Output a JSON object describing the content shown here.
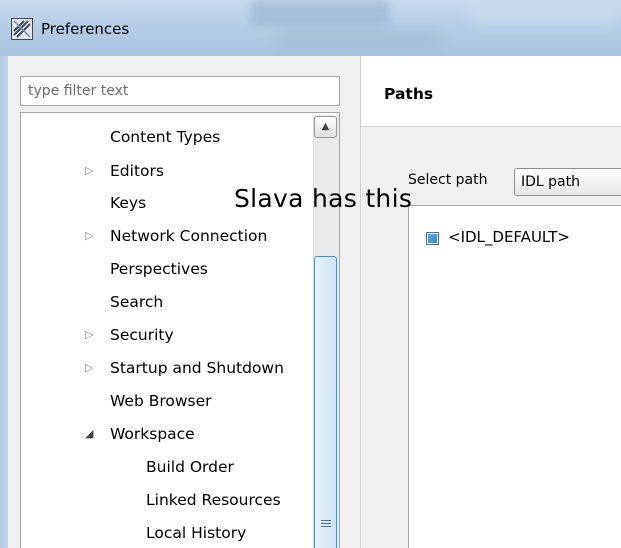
{
  "window": {
    "title": "Preferences",
    "icon": "preferences-icon"
  },
  "filter": {
    "placeholder": "type filter text"
  },
  "tree": {
    "items": [
      {
        "label": "Content Types",
        "expandable": false,
        "expanded": false,
        "level": 1
      },
      {
        "label": "Editors",
        "expandable": true,
        "expanded": false,
        "level": 1
      },
      {
        "label": "Keys",
        "expandable": false,
        "expanded": false,
        "level": 1
      },
      {
        "label": "Network Connection",
        "expandable": true,
        "expanded": false,
        "level": 1
      },
      {
        "label": "Perspectives",
        "expandable": false,
        "expanded": false,
        "level": 1
      },
      {
        "label": "Search",
        "expandable": false,
        "expanded": false,
        "level": 1
      },
      {
        "label": "Security",
        "expandable": true,
        "expanded": false,
        "level": 1
      },
      {
        "label": "Startup and Shutdown",
        "expandable": true,
        "expanded": false,
        "level": 1
      },
      {
        "label": "Web Browser",
        "expandable": false,
        "expanded": false,
        "level": 1
      },
      {
        "label": "Workspace",
        "expandable": true,
        "expanded": true,
        "level": 1
      },
      {
        "label": "Build Order",
        "expandable": false,
        "expanded": false,
        "level": 2
      },
      {
        "label": "Linked Resources",
        "expandable": false,
        "expanded": false,
        "level": 2
      },
      {
        "label": "Local History",
        "expandable": false,
        "expanded": false,
        "level": 2
      }
    ]
  },
  "page": {
    "title": "Paths",
    "select_label": "Select path",
    "select_value": "IDL path",
    "paths": [
      {
        "label": "<IDL_DEFAULT>",
        "checked": true
      }
    ]
  },
  "annotation": {
    "text": "Slava has this"
  },
  "colors": {
    "titlebar": "#b6cde6",
    "scroll_thumb_border": "#4f8fc6",
    "checkbox_fill": "#2f7fc2"
  }
}
